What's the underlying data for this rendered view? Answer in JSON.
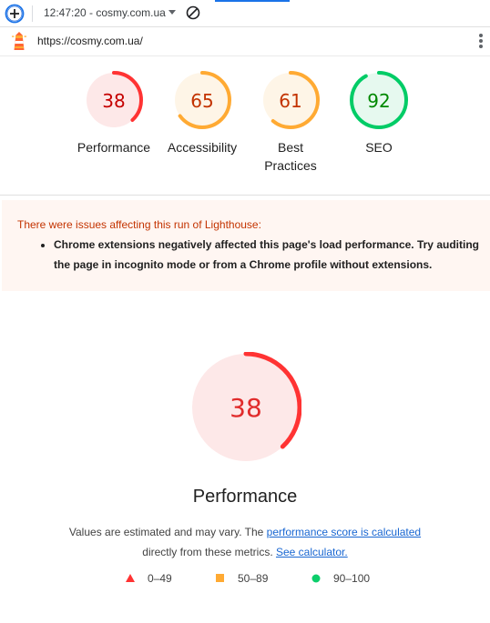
{
  "toolbar": {
    "report_label": "12:47:20 - cosmy.com.ua",
    "new_report_icon": "plus-circle-icon",
    "clear_icon": "block-icon"
  },
  "urlbar": {
    "url": "https://cosmy.com.ua/",
    "logo_icon": "lighthouse-icon",
    "menu_icon": "kebab-menu-icon"
  },
  "gauges": [
    {
      "score": "38",
      "label": "Performance",
      "rating": "fail",
      "color": "#ff3333",
      "bg": "#fde8e8",
      "text_color": "#c50000"
    },
    {
      "score": "65",
      "label": "Accessibility",
      "rating": "average",
      "color": "#ffaa33",
      "bg": "#fef5e7",
      "text_color": "#c33300"
    },
    {
      "score": "61",
      "label_line1": "Best",
      "label_line2": "Practices",
      "rating": "average",
      "color": "#ffaa33",
      "bg": "#fef5e7",
      "text_color": "#c33300"
    },
    {
      "score": "92",
      "label": "SEO",
      "rating": "pass",
      "color": "#00cc66",
      "bg": "#e6f9ef",
      "text_color": "#008800"
    }
  ],
  "warning": {
    "title": "There were issues affecting this run of Lighthouse:",
    "item": "Chrome extensions negatively affected this page's load performance. Try auditing the page in incognito mode or from a Chrome profile without extensions."
  },
  "performance": {
    "score": "38",
    "title": "Performance",
    "desc_prefix": "Values are estimated and may vary. The ",
    "desc_link": "performance score is calculated",
    "desc_middle": "directly from these metrics. ",
    "calc_link": "See calculator."
  },
  "legend": [
    {
      "range": "0–49",
      "shape": "triangle",
      "color": "#ff3333"
    },
    {
      "range": "50–89",
      "shape": "square",
      "color": "#ffaa33"
    },
    {
      "range": "90–100",
      "shape": "circle",
      "color": "#0cce6b"
    }
  ]
}
